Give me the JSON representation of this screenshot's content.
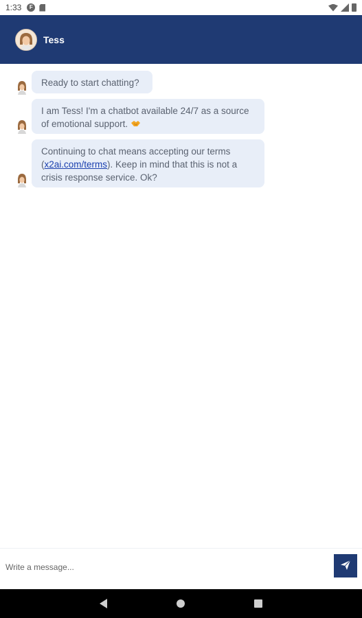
{
  "status_bar": {
    "time": "1:33",
    "app_icon": "F"
  },
  "header": {
    "title": "Tess",
    "avatar_icon": "tess-avatar"
  },
  "messages": [
    {
      "sender": "Tess",
      "text": "Ready to start chatting?"
    },
    {
      "sender": "Tess",
      "text": "I am Tess! I'm a chatbot available 24/7 as a source of emotional support. ",
      "emoji": "handshake-emoji"
    },
    {
      "sender": "Tess",
      "text_before": "Continuing to chat means accepting our terms (",
      "link": "x2ai.com/terms",
      "text_after": "). Keep in mind that this is not a crisis response service. Ok?"
    }
  ],
  "input": {
    "placeholder": "Write a message..."
  },
  "colors": {
    "header_bg": "#1f3a73",
    "bubble_bg": "#e8eef8",
    "link": "#1a3fae"
  }
}
